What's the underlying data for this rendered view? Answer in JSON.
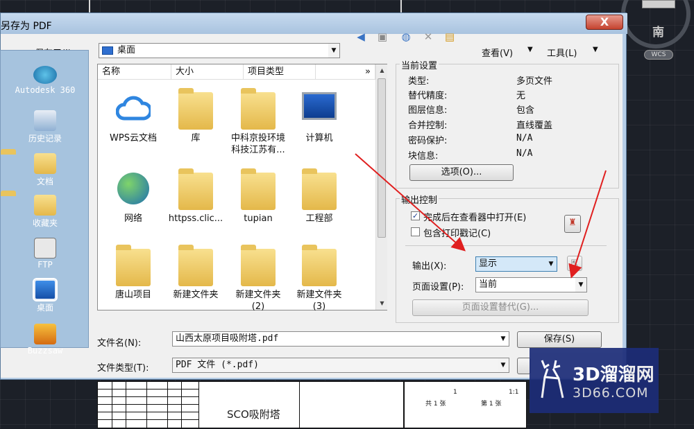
{
  "dialog": {
    "title": "另存为 PDF",
    "close_label": "X"
  },
  "toolbar": {
    "save_in_label": "保存于(I):",
    "save_in_value": "桌面",
    "view_label": "查看(V)",
    "tools_label": "工具(L)"
  },
  "places": [
    {
      "label": "Autodesk 360",
      "icon": "cloud-icon"
    },
    {
      "label": "历史记录",
      "icon": "history-icon"
    },
    {
      "label": "文档",
      "icon": "documents-icon"
    },
    {
      "label": "收藏夹",
      "icon": "favorites-icon"
    },
    {
      "label": "FTP",
      "icon": "ftp-icon"
    },
    {
      "label": "桌面",
      "icon": "desktop-icon"
    },
    {
      "label": "Buzzsaw",
      "icon": "buzzsaw-icon"
    }
  ],
  "filelist": {
    "columns": [
      "名称",
      "大小",
      "项目类型"
    ],
    "more": "»",
    "files": [
      {
        "name": "WPS云文档",
        "icon": "wps-cloud-icon"
      },
      {
        "name": "库",
        "icon": "library-icon"
      },
      {
        "name": "中科京投环境\n科技江苏有...",
        "icon": "user-folder-icon"
      },
      {
        "name": "计算机",
        "icon": "computer-icon"
      },
      {
        "name": "网络",
        "icon": "network-icon"
      },
      {
        "name": "httpss.clic...",
        "icon": "folder-icon"
      },
      {
        "name": "tupian",
        "icon": "folder-icon"
      },
      {
        "name": "工程部",
        "icon": "folder-icon"
      },
      {
        "name": "唐山项目",
        "icon": "folder-icon"
      },
      {
        "name": "新建文件夹",
        "icon": "folder-icon"
      },
      {
        "name": "新建文件夹\n(2)",
        "icon": "folder-icon"
      },
      {
        "name": "新建文件夹\n(3)",
        "icon": "folder-icon"
      }
    ]
  },
  "current_settings": {
    "title": "当前设置",
    "rows": [
      {
        "key": "类型:",
        "value": "多页文件"
      },
      {
        "key": "替代精度:",
        "value": "无"
      },
      {
        "key": "图层信息:",
        "value": "包含"
      },
      {
        "key": "合并控制:",
        "value": "直线覆盖"
      },
      {
        "key": "密码保护:",
        "value": "N/A"
      },
      {
        "key": "块信息:",
        "value": "N/A"
      }
    ],
    "options_button": "选项(O)..."
  },
  "output_control": {
    "title": "输出控制",
    "open_in_viewer": "完成后在查看器中打开(E)",
    "open_in_viewer_checked": true,
    "include_plot_stamp": "包含打印戳记(C)",
    "include_plot_stamp_checked": false,
    "output_label": "输出(X):",
    "output_value": "显示",
    "page_setup_label": "页面设置(P):",
    "page_setup_value": "当前",
    "page_setup_override": "页面设置替代(G)..."
  },
  "bottom": {
    "filename_label": "文件名(N):",
    "filename_value": "山西太原项目吸附塔.pdf",
    "filetype_label": "文件类型(T):",
    "filetype_value": "PDF 文件 (*.pdf)",
    "save_button": "保存(S)"
  },
  "cad": {
    "compass": "南",
    "wcs": "WCS",
    "drawing_title": "SCO吸附塔",
    "tb2_row1": [
      "1",
      "1:1"
    ],
    "tb2_row2": [
      "共 1 张",
      "第 1 张"
    ]
  },
  "watermark": {
    "brand": "3D溜溜网",
    "site": "3D66.COM"
  },
  "colors": {
    "arrow": "#e01f1f",
    "dialog_frame": "#b6cde6",
    "places_bg": "#a6c3de",
    "watermark_bg": "#1c2c78"
  }
}
